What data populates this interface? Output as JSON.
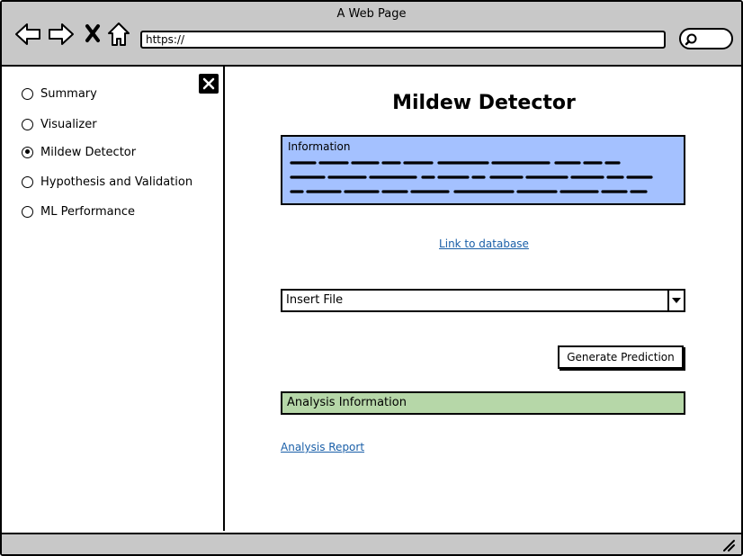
{
  "window": {
    "title": "A Web Page"
  },
  "browser": {
    "url": "https://"
  },
  "sidebar": {
    "items": [
      {
        "label": "Summary",
        "selected": false
      },
      {
        "label": "Visualizer",
        "selected": false
      },
      {
        "label": "Mildew Detector",
        "selected": true
      },
      {
        "label": "Hypothesis and Validation",
        "selected": false
      },
      {
        "label": "ML Performance",
        "selected": false
      }
    ]
  },
  "main": {
    "title": "Mildew Detector",
    "info_box": {
      "heading": "Information",
      "color": "#a4c1ff"
    },
    "database_link": "Link to database",
    "file_select": {
      "value": "Insert File"
    },
    "predict_button": "Generate Prediction",
    "analysis_box": {
      "label": "Analysis Information",
      "color": "#b6d7a8"
    },
    "report_link": "Analysis Report"
  }
}
